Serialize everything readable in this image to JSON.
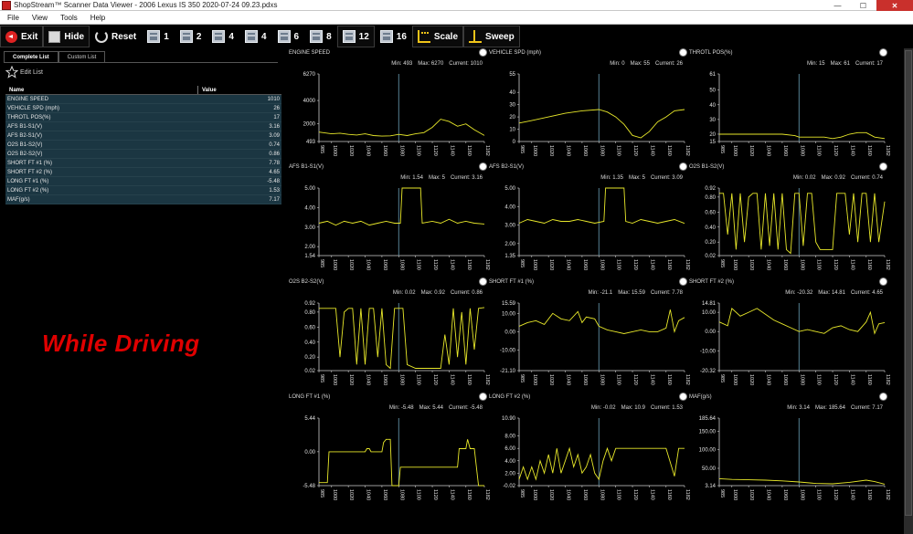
{
  "window": {
    "title": "ShopStream™ Scanner Data Viewer - 2006 Lexus IS 350 2020-07-24 09.23.pdxs",
    "min_glyph": "—",
    "max_glyph": "☐",
    "close_glyph": "✕"
  },
  "menu": [
    "File",
    "View",
    "Tools",
    "Help"
  ],
  "toolbar": [
    {
      "id": "exit",
      "label": "Exit",
      "icon": "exit-icon"
    },
    {
      "id": "hide",
      "label": "Hide",
      "icon": "hide-icon"
    },
    {
      "id": "reset",
      "label": "Reset",
      "icon": "reset-icon"
    },
    {
      "id": "layout-1",
      "label": "1",
      "icon": "grid-layout-icon"
    },
    {
      "id": "layout-2",
      "label": "2",
      "icon": "grid-layout-icon"
    },
    {
      "id": "layout-4a",
      "label": "4",
      "icon": "grid-layout-icon"
    },
    {
      "id": "layout-4b",
      "label": "4",
      "icon": "grid-layout-icon"
    },
    {
      "id": "layout-6",
      "label": "6",
      "icon": "grid-layout-icon"
    },
    {
      "id": "layout-8",
      "label": "8",
      "icon": "grid-layout-icon"
    },
    {
      "id": "layout-12",
      "label": "12",
      "icon": "grid-layout-icon",
      "active": true
    },
    {
      "id": "layout-16",
      "label": "16",
      "icon": "grid-layout-icon"
    },
    {
      "id": "scale",
      "label": "Scale",
      "icon": "scale-icon"
    },
    {
      "id": "sweep",
      "label": "Sweep",
      "icon": "sweep-icon"
    }
  ],
  "left_panel": {
    "tabs": [
      {
        "label": "Complete List",
        "active": true
      },
      {
        "label": "Custom List",
        "active": false
      }
    ],
    "edit_list_label": "Edit List",
    "table_header": {
      "name": "Name",
      "value": "Value"
    },
    "rows": [
      {
        "name": "ENGINE SPEED",
        "value": "1010"
      },
      {
        "name": "VEHICLE SPD (mph)",
        "value": "26"
      },
      {
        "name": "THROTL POS(%)",
        "value": "17"
      },
      {
        "name": "AFS B1-S1(V)",
        "value": "3.16"
      },
      {
        "name": "AFS B2-S1(V)",
        "value": "3.09"
      },
      {
        "name": "O2S B1-S2(V)",
        "value": "0.74"
      },
      {
        "name": "O2S B2-S2(V)",
        "value": "0.86"
      },
      {
        "name": "SHORT FT #1 (%)",
        "value": "7.78"
      },
      {
        "name": "SHORT FT #2 (%)",
        "value": "4.65"
      },
      {
        "name": "LONG FT #1 (%)",
        "value": "-5.48"
      },
      {
        "name": "LONG FT #2 (%)",
        "value": "1.53"
      },
      {
        "name": "MAF(g/s)",
        "value": "7.17"
      }
    ]
  },
  "overlay_text": "While Driving",
  "colors": {
    "trace": "#e8e82a",
    "cursor": "#5f8fa3",
    "axis": "#cfcfcf",
    "tab_row_bg": "#1b3642",
    "overlay": "#e00000"
  },
  "x_ticks": [
    "985",
    "1000",
    "1020",
    "1040",
    "1060",
    "1080",
    "1100",
    "1120",
    "1140",
    "1160",
    "1182"
  ],
  "chart_data": [
    {
      "type": "line",
      "title": "ENGINE SPEED",
      "min_label": "Min: 493",
      "max_label": "Max: 6270",
      "current_label": "Current: 1010",
      "yticks": [
        "6270",
        "4000",
        "2000",
        "493"
      ],
      "yvals": [
        6270,
        4000,
        2000,
        493
      ],
      "ylim": [
        493,
        6270
      ],
      "cursor_x": 1080,
      "x": [
        985,
        1000,
        1010,
        1020,
        1030,
        1040,
        1050,
        1060,
        1070,
        1080,
        1090,
        1100,
        1110,
        1120,
        1130,
        1140,
        1150,
        1160,
        1170,
        1182
      ],
      "y": [
        1300,
        1150,
        1200,
        1100,
        1050,
        1150,
        1000,
        950,
        980,
        1100,
        1000,
        1150,
        1250,
        1700,
        2400,
        2200,
        1800,
        2000,
        1500,
        1010
      ]
    },
    {
      "type": "line",
      "title": "VEHICLE SPD (mph)",
      "min_label": "Min: 0",
      "max_label": "Max: 55",
      "current_label": "Current: 26",
      "yticks": [
        "55",
        "40",
        "30",
        "20",
        "10",
        "0"
      ],
      "yvals": [
        55,
        40,
        30,
        20,
        10,
        0
      ],
      "ylim": [
        0,
        55
      ],
      "cursor_x": 1080,
      "x": [
        985,
        1000,
        1020,
        1040,
        1060,
        1080,
        1090,
        1100,
        1110,
        1120,
        1130,
        1140,
        1150,
        1160,
        1170,
        1182
      ],
      "y": [
        15,
        17,
        20,
        23,
        25,
        26,
        24,
        20,
        14,
        5,
        3,
        8,
        16,
        20,
        25,
        26
      ]
    },
    {
      "type": "line",
      "title": "THROTL POS(%)",
      "min_label": "Min: 15",
      "max_label": "Max: 61",
      "current_label": "Current: 17",
      "yticks": [
        "61",
        "50",
        "40",
        "30",
        "20",
        "15"
      ],
      "yvals": [
        61,
        50,
        40,
        30,
        20,
        15
      ],
      "ylim": [
        15,
        61
      ],
      "cursor_x": 1080,
      "x": [
        985,
        1000,
        1020,
        1040,
        1060,
        1075,
        1080,
        1100,
        1110,
        1120,
        1130,
        1140,
        1150,
        1160,
        1170,
        1182
      ],
      "y": [
        20,
        20,
        20,
        20,
        20,
        19,
        18,
        18,
        18,
        17,
        18,
        20,
        21,
        21,
        18,
        17
      ]
    },
    {
      "type": "line",
      "title": "AFS B1-S1(V)",
      "min_label": "Min: 1.54",
      "max_label": "Max: 5",
      "current_label": "Current: 3.16",
      "yticks": [
        "5.00",
        "4.00",
        "3.00",
        "2.00",
        "1.54"
      ],
      "yvals": [
        5,
        4,
        3,
        2,
        1.54
      ],
      "ylim": [
        1.54,
        5
      ],
      "cursor_x": 1080,
      "x": [
        985,
        995,
        1005,
        1015,
        1025,
        1035,
        1045,
        1055,
        1065,
        1075,
        1082,
        1084,
        1100,
        1106,
        1108,
        1120,
        1130,
        1140,
        1150,
        1160,
        1170,
        1182
      ],
      "y": [
        3.2,
        3.3,
        3.1,
        3.3,
        3.2,
        3.3,
        3.1,
        3.2,
        3.3,
        3.2,
        3.2,
        5.0,
        5.0,
        5.0,
        3.2,
        3.3,
        3.2,
        3.4,
        3.2,
        3.3,
        3.2,
        3.16
      ]
    },
    {
      "type": "line",
      "title": "AFS B2-S1(V)",
      "min_label": "Min: 1.35",
      "max_label": "Max: 5",
      "current_label": "Current: 3.09",
      "yticks": [
        "5.00",
        "4.00",
        "3.00",
        "2.00",
        "1.35"
      ],
      "yvals": [
        5,
        4,
        3,
        2,
        1.35
      ],
      "ylim": [
        1.35,
        5
      ],
      "cursor_x": 1080,
      "x": [
        985,
        995,
        1005,
        1015,
        1025,
        1035,
        1045,
        1055,
        1065,
        1075,
        1086,
        1088,
        1100,
        1110,
        1112,
        1120,
        1130,
        1140,
        1150,
        1160,
        1170,
        1182
      ],
      "y": [
        3.1,
        3.3,
        3.2,
        3.1,
        3.3,
        3.2,
        3.2,
        3.3,
        3.2,
        3.1,
        3.2,
        5.0,
        5.0,
        5.0,
        3.2,
        3.1,
        3.3,
        3.2,
        3.1,
        3.2,
        3.3,
        3.09
      ]
    },
    {
      "type": "line",
      "title": "O2S B1-S2(V)",
      "min_label": "Min: 0.02",
      "max_label": "Max: 0.92",
      "current_label": "Current: 0.74",
      "yticks": [
        "0.92",
        "0.80",
        "0.60",
        "0.40",
        "0.20",
        "0.02"
      ],
      "yvals": [
        0.92,
        0.8,
        0.6,
        0.4,
        0.2,
        0.02
      ],
      "ylim": [
        0.02,
        0.92
      ],
      "cursor_x": 1080,
      "x": [
        985,
        990,
        995,
        1000,
        1005,
        1010,
        1015,
        1020,
        1025,
        1030,
        1035,
        1040,
        1045,
        1050,
        1055,
        1060,
        1065,
        1070,
        1075,
        1080,
        1085,
        1090,
        1095,
        1100,
        1105,
        1110,
        1115,
        1120,
        1125,
        1135,
        1140,
        1145,
        1150,
        1155,
        1160,
        1165,
        1170,
        1175,
        1182
      ],
      "y": [
        0.85,
        0.85,
        0.3,
        0.85,
        0.1,
        0.85,
        0.2,
        0.8,
        0.85,
        0.85,
        0.1,
        0.85,
        0.15,
        0.85,
        0.1,
        0.85,
        0.1,
        0.05,
        0.85,
        0.85,
        0.15,
        0.85,
        0.85,
        0.2,
        0.1,
        0.1,
        0.1,
        0.1,
        0.85,
        0.85,
        0.3,
        0.85,
        0.2,
        0.85,
        0.85,
        0.2,
        0.85,
        0.2,
        0.74
      ]
    },
    {
      "type": "line",
      "title": "O2S B2-S2(V)",
      "min_label": "Min: 0.02",
      "max_label": "Max: 0.92",
      "current_label": "Current: 0.86",
      "yticks": [
        "0.92",
        "0.80",
        "0.60",
        "0.40",
        "0.20",
        "0.02"
      ],
      "yvals": [
        0.92,
        0.8,
        0.6,
        0.4,
        0.2,
        0.02
      ],
      "ylim": [
        0.02,
        0.92
      ],
      "cursor_x": 1080,
      "x": [
        985,
        995,
        1000,
        1005,
        1010,
        1015,
        1020,
        1025,
        1030,
        1035,
        1040,
        1045,
        1050,
        1055,
        1060,
        1065,
        1070,
        1075,
        1080,
        1085,
        1090,
        1100,
        1110,
        1120,
        1130,
        1135,
        1140,
        1145,
        1150,
        1155,
        1160,
        1165,
        1170,
        1175,
        1182
      ],
      "y": [
        0.85,
        0.85,
        0.85,
        0.85,
        0.2,
        0.8,
        0.85,
        0.85,
        0.1,
        0.85,
        0.1,
        0.85,
        0.85,
        0.2,
        0.85,
        0.1,
        0.05,
        0.85,
        0.85,
        0.85,
        0.1,
        0.05,
        0.05,
        0.05,
        0.05,
        0.5,
        0.1,
        0.85,
        0.2,
        0.8,
        0.1,
        0.85,
        0.3,
        0.85,
        0.86
      ]
    },
    {
      "type": "line",
      "title": "SHORT FT #1 (%)",
      "min_label": "Min: -21.1",
      "max_label": "Max: 15.59",
      "current_label": "Current: 7.78",
      "yticks": [
        "15.59",
        "10.00",
        "0.00",
        "-10.00",
        "-21.10"
      ],
      "yvals": [
        15.59,
        10,
        0,
        -10,
        -21.1
      ],
      "ylim": [
        -21.1,
        15.59
      ],
      "cursor_x": 1080,
      "x": [
        985,
        995,
        1005,
        1015,
        1025,
        1035,
        1045,
        1055,
        1060,
        1065,
        1075,
        1080,
        1090,
        1100,
        1110,
        1120,
        1130,
        1140,
        1150,
        1160,
        1165,
        1170,
        1175,
        1182
      ],
      "y": [
        3,
        5,
        6,
        4,
        10,
        7,
        6,
        11,
        5,
        8,
        7,
        3,
        1,
        0,
        -1,
        0,
        1,
        0,
        0,
        2,
        12,
        0,
        6,
        7.78
      ]
    },
    {
      "type": "line",
      "title": "SHORT FT #2 (%)",
      "min_label": "Min: -20.32",
      "max_label": "Max: 14.81",
      "current_label": "Current: 4.65",
      "yticks": [
        "14.81",
        "10.00",
        "0.00",
        "-10.00",
        "-20.32"
      ],
      "yvals": [
        14.81,
        10,
        0,
        -10,
        -20.32
      ],
      "ylim": [
        -20.32,
        14.81
      ],
      "cursor_x": 1080,
      "x": [
        985,
        995,
        1000,
        1010,
        1020,
        1030,
        1040,
        1050,
        1060,
        1070,
        1080,
        1090,
        1100,
        1110,
        1120,
        1130,
        1140,
        1150,
        1160,
        1165,
        1170,
        1175,
        1182
      ],
      "y": [
        5,
        3,
        12,
        8,
        10,
        12,
        9,
        6,
        4,
        2,
        0,
        1,
        0,
        -1,
        2,
        3,
        1,
        0,
        5,
        10,
        -1,
        4,
        4.65
      ]
    },
    {
      "type": "line",
      "title": "LONG FT #1 (%)",
      "min_label": "Min: -5.48",
      "max_label": "Max: 5.44",
      "current_label": "Current: -5.48",
      "yticks": [
        "5.44",
        "0.00",
        "-5.48"
      ],
      "yvals": [
        5.44,
        0,
        -5.48
      ],
      "ylim": [
        -5.48,
        5.44
      ],
      "cursor_x": 1080,
      "x": [
        985,
        995,
        997,
        1040,
        1042,
        1045,
        1047,
        1060,
        1062,
        1065,
        1070,
        1072,
        1080,
        1082,
        1090,
        1092,
        1100,
        1120,
        1140,
        1150,
        1152,
        1160,
        1162,
        1165,
        1170,
        1175,
        1182
      ],
      "y": [
        -5,
        -5,
        0,
        0,
        0.5,
        0.5,
        0,
        0,
        1.5,
        2,
        2,
        -5.48,
        -5.48,
        -2.5,
        -2.5,
        -2.5,
        -2.5,
        -2.5,
        -2.5,
        -2.5,
        0.5,
        0.5,
        2,
        0.5,
        0.5,
        -5.48,
        -5.48
      ]
    },
    {
      "type": "line",
      "title": "LONG FT #2 (%)",
      "min_label": "Min: -0.02",
      "max_label": "Max: 10.9",
      "current_label": "Current: 1.53",
      "yticks": [
        "10.90",
        "8.00",
        "6.00",
        "4.00",
        "2.00",
        "-0.02"
      ],
      "yvals": [
        10.9,
        8,
        6,
        4,
        2,
        -0.02
      ],
      "ylim": [
        -0.02,
        10.9
      ],
      "cursor_x": 1080,
      "x": [
        985,
        990,
        995,
        1000,
        1005,
        1010,
        1015,
        1020,
        1025,
        1030,
        1035,
        1040,
        1045,
        1050,
        1055,
        1060,
        1065,
        1070,
        1075,
        1080,
        1085,
        1090,
        1095,
        1100,
        1110,
        1120,
        1130,
        1140,
        1150,
        1160,
        1170,
        1175,
        1182
      ],
      "y": [
        1,
        3,
        1,
        3,
        1,
        4,
        2,
        5,
        2,
        6,
        2,
        4,
        6,
        3,
        5,
        2,
        3,
        5,
        2,
        1,
        4,
        6,
        4,
        6,
        6,
        6,
        6,
        6,
        6,
        6,
        1.5,
        6,
        6
      ]
    },
    {
      "type": "line",
      "title": "MAF(g/s)",
      "min_label": "Min: 3.14",
      "max_label": "Max: 185.64",
      "current_label": "Current: 7.17",
      "yticks": [
        "185.64",
        "150.00",
        "100.00",
        "50.00",
        "3.14"
      ],
      "yvals": [
        185.64,
        150,
        100,
        50,
        3.14
      ],
      "ylim": [
        3.14,
        185.64
      ],
      "cursor_x": 1080,
      "x": [
        985,
        1000,
        1020,
        1040,
        1060,
        1080,
        1100,
        1120,
        1140,
        1160,
        1170,
        1182
      ],
      "y": [
        22,
        20,
        19,
        18,
        16,
        13,
        9,
        8,
        12,
        18,
        14,
        7.17
      ]
    }
  ]
}
